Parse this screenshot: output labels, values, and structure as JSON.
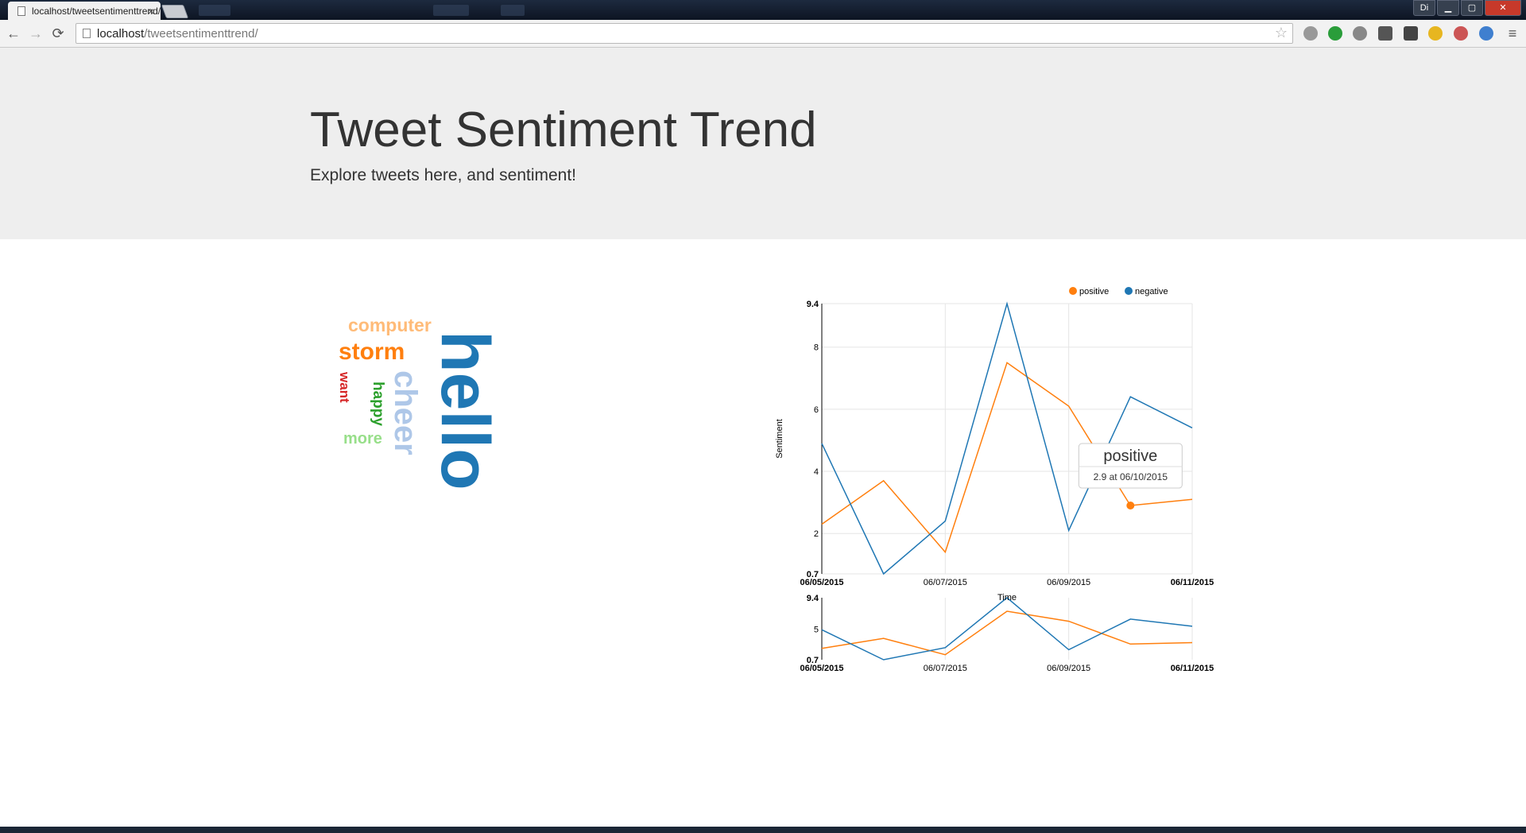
{
  "browser": {
    "tab_title": "localhost/tweetsentimenttrend/",
    "tab_close": "×",
    "url_host": "localhost",
    "url_path": "/tweetsentimenttrend/",
    "user_badge": "Di",
    "nav_back": "←",
    "nav_forward": "→",
    "nav_reload": "⟳",
    "star": "☆",
    "menu": "≡",
    "colors": {
      "tabstrip": "#1b2639",
      "close_button": "#c7392a"
    }
  },
  "page": {
    "title": "Tweet Sentiment Trend",
    "subtitle": "Explore tweets here, and sentiment!"
  },
  "word_cloud": {
    "words": [
      {
        "text": "hello",
        "color": "#1f77b4",
        "rotate": 90
      },
      {
        "text": "cheer",
        "color": "#aec7e8",
        "rotate": 90
      },
      {
        "text": "computer",
        "color": "#ffbb78",
        "rotate": 0
      },
      {
        "text": "storm",
        "color": "#ff7f0e",
        "rotate": 0
      },
      {
        "text": "happy",
        "color": "#2ca02c",
        "rotate": 90
      },
      {
        "text": "want",
        "color": "#d62728",
        "rotate": 90
      },
      {
        "text": "more",
        "color": "#98df8a",
        "rotate": 0
      }
    ]
  },
  "chart_data": {
    "type": "line",
    "title": "",
    "xlabel": "Time",
    "ylabel": "Sentiment",
    "x": [
      "06/05/2015",
      "06/06/2015",
      "06/07/2015",
      "06/08/2015",
      "06/09/2015",
      "06/10/2015",
      "06/11/2015"
    ],
    "x_tick_labels": [
      "06/05/2015",
      "06/07/2015",
      "06/09/2015",
      "06/11/2015"
    ],
    "y_tick_labels": [
      "0.7",
      "2",
      "4",
      "6",
      "8",
      "9.4"
    ],
    "ylim": [
      0.7,
      9.4
    ],
    "grid": true,
    "legend_position": "top-right",
    "series": [
      {
        "name": "positive",
        "color": "#ff7f0e",
        "values": [
          2.3,
          3.7,
          1.4,
          7.5,
          6.1,
          2.9,
          3.1
        ]
      },
      {
        "name": "negative",
        "color": "#1f77b4",
        "values": [
          4.9,
          0.7,
          2.4,
          9.4,
          2.1,
          6.4,
          5.4
        ]
      }
    ],
    "overview": {
      "y_tick_labels": [
        "0.7",
        "5",
        "9.4"
      ],
      "ylim": [
        0.7,
        9.4
      ]
    },
    "tooltip": {
      "series": "positive",
      "title": "positive",
      "text": "2.9 at 06/10/2015",
      "x": "06/10/2015",
      "y": 2.9
    }
  }
}
